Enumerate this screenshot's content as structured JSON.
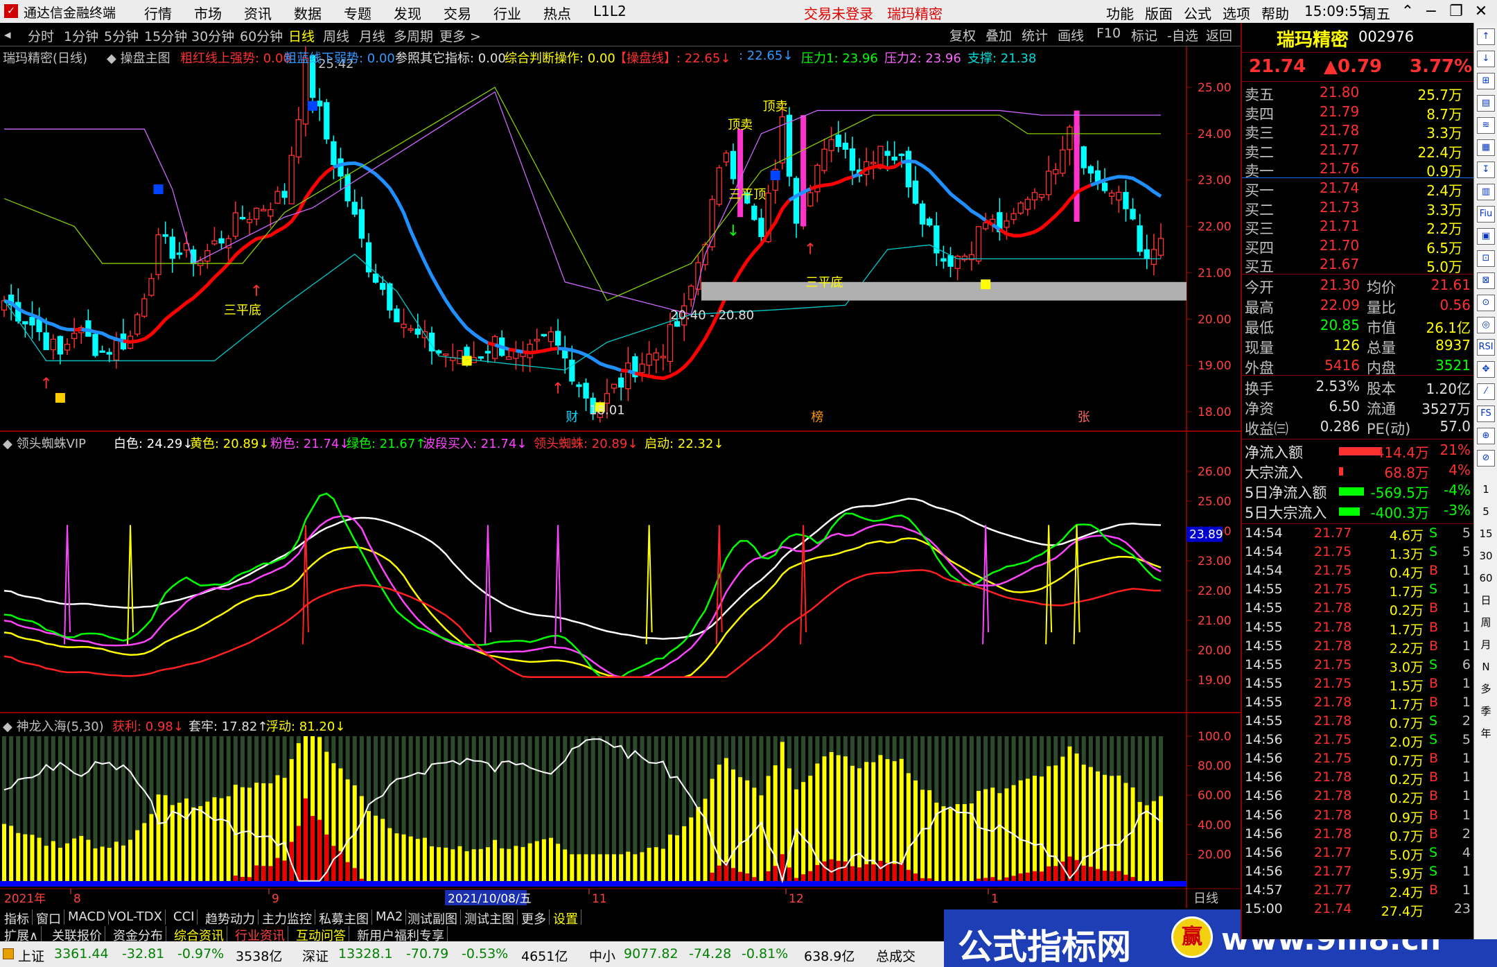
{
  "app": {
    "title": "通达信金融终端",
    "menu": [
      "行情",
      "市场",
      "资讯",
      "数据",
      "专题",
      "发现",
      "交易",
      "行业",
      "热点",
      "L1L2"
    ],
    "login": "交易未登录",
    "stock_name": "瑞玛精密",
    "right_menu": [
      "功能",
      "版面",
      "公式",
      "选项",
      "帮助"
    ],
    "time": "15:09:55",
    "weekday": "周五"
  },
  "toolbar": {
    "periods": [
      "分时",
      "1分钟",
      "5分钟",
      "15分钟",
      "30分钟",
      "60分钟",
      "日线",
      "周线",
      "月线",
      "多周期",
      "更多 >"
    ],
    "right": [
      "复权",
      "叠加",
      "统计",
      "画线",
      "F10",
      "标记",
      "-自选",
      "返回"
    ]
  },
  "main_chart": {
    "header": [
      {
        "t": "瑞玛精密(日线)",
        "c": "#c0c0c0"
      },
      {
        "t": "◆ 操盘主图",
        "c": "#c0c0c0"
      },
      {
        "t": "粗红线上强势: 0.00",
        "c": "#ff3030"
      },
      {
        "t": "粗蓝线下弱势: 0.00",
        "c": "#3399ff"
      },
      {
        "t": "参照其它指标: 0.00",
        "c": "#e0e0e0"
      },
      {
        "t": "综合判断操作: 0.00",
        "c": "#ffff00"
      },
      {
        "t": "【操盘线】: 22.65↓",
        "c": "#ff3030"
      },
      {
        "t": ": 22.65↓",
        "c": "#3399ff"
      },
      {
        "t": "压力1: 23.96",
        "c": "#00ff00"
      },
      {
        "t": "压力2: 23.96",
        "c": "#ff66ff"
      },
      {
        "t": "支撑: 21.38",
        "c": "#00dddd"
      }
    ],
    "price_ticks": [
      "25.00",
      "24.00",
      "23.00",
      "22.00",
      "21.00",
      "20.00",
      "19.00",
      "18.00"
    ],
    "annotations": [
      {
        "t": "25.42",
        "c": "#c0c0c0"
      },
      {
        "t": "三平底",
        "c": "#ffff00"
      },
      {
        "t": "三平底",
        "c": "#ffff00"
      },
      {
        "t": "三平顶",
        "c": "#ffff00"
      },
      {
        "t": "顶卖",
        "c": "#ffff00"
      },
      {
        "t": "顶卖",
        "c": "#ffff00"
      },
      {
        "t": "20.40 - 20.80",
        "c": "#e0e0e0"
      },
      {
        "t": "18.01",
        "c": "#e0e0e0"
      },
      {
        "t": "财",
        "c": "#00ddff"
      },
      {
        "t": "榜",
        "c": "#ff9900"
      },
      {
        "t": "张",
        "c": "#ff6666"
      }
    ]
  },
  "spider": {
    "header": [
      {
        "t": "◆ 领头蜘蛛VIP",
        "c": "#c0c0c0"
      },
      {
        "t": "白色: 24.29↓",
        "c": "#ffffff"
      },
      {
        "t": "黄色: 20.89↓",
        "c": "#ffff00"
      },
      {
        "t": "粉色: 21.74↓",
        "c": "#ff44ff"
      },
      {
        "t": "绿色: 21.67↑",
        "c": "#00ff00"
      },
      {
        "t": "波段买入: 21.74↓",
        "c": "#ff44ff"
      },
      {
        "t": "领头蜘蛛: 20.89↓",
        "c": "#ff3030"
      },
      {
        "t": "启动: 22.32↓",
        "c": "#ffff00"
      }
    ],
    "ticks": [
      "26.00",
      "25.00",
      "24.00",
      "23.00",
      "22.00",
      "21.00",
      "20.00",
      "19.00"
    ],
    "highlight": "23.89"
  },
  "dragon": {
    "header": [
      {
        "t": "◆ 神龙入海(5,30)",
        "c": "#c0c0c0"
      },
      {
        "t": "获利: 0.98↓",
        "c": "#ff3030"
      },
      {
        "t": "套牢: 17.82↑",
        "c": "#e0e0e0"
      },
      {
        "t": "浮动: 81.20↓",
        "c": "#ffff00"
      }
    ],
    "ticks": [
      "100.0",
      "80.00",
      "60.00",
      "40.00",
      "20.00"
    ]
  },
  "date_axis": {
    "labels": [
      "2021年",
      "8",
      "9",
      "2021/10/08/五",
      "11",
      "12",
      "1"
    ],
    "period": "日线"
  },
  "bottom_tabs": [
    "指标",
    "窗口",
    "MACD",
    "VOL-TDX",
    "CCI",
    "趋势动力",
    "主力监控",
    "私募主图",
    "MA2",
    "测试副图",
    "测试主图",
    "更多",
    "设置"
  ],
  "bottom_tabs2": [
    "扩展∧",
    "关联报价",
    "资金分布",
    "综合资讯",
    "行业资讯",
    "互动问答",
    "新用户福利专享"
  ],
  "status": {
    "items": [
      {
        "name": "上证",
        "v": "3361.44",
        "d": "-32.81",
        "p": "-0.97%",
        "amt": "3538亿"
      },
      {
        "name": "深证",
        "v": "13328.1",
        "d": "-70.79",
        "p": "-0.53%",
        "amt": "4651亿"
      },
      {
        "name": "中小",
        "v": "9077.82",
        "d": "-74.28",
        "p": "-0.81%",
        "amt": "638.9亿"
      }
    ],
    "tail": "总成交"
  },
  "quote": {
    "name": "瑞玛精密",
    "code": "002976",
    "price": "21.74",
    "change": "▲0.79",
    "pct": "3.77%",
    "asks": [
      [
        "卖五",
        "21.80",
        "25.7万"
      ],
      [
        "卖四",
        "21.79",
        "8.7万"
      ],
      [
        "卖三",
        "21.78",
        "3.3万"
      ],
      [
        "卖二",
        "21.77",
        "22.4万"
      ],
      [
        "卖一",
        "21.76",
        "0.9万"
      ]
    ],
    "bids": [
      [
        "买一",
        "21.74",
        "2.4万"
      ],
      [
        "买二",
        "21.73",
        "3.3万"
      ],
      [
        "买三",
        "21.71",
        "2.2万"
      ],
      [
        "买四",
        "21.70",
        "6.5万"
      ],
      [
        "买五",
        "21.67",
        "5.0万"
      ]
    ],
    "stats": [
      [
        "今开",
        "21.30",
        "均价",
        "21.61"
      ],
      [
        "最高",
        "22.09",
        "量比",
        "0.56"
      ],
      [
        "最低",
        "20.85",
        "市值",
        "26.1亿"
      ],
      [
        "现量",
        "126",
        "总量",
        "8937"
      ],
      [
        "外盘",
        "5416",
        "内盘",
        "3521"
      ]
    ],
    "stats2": [
      [
        "换手",
        "2.53%",
        "股本",
        "1.20亿"
      ],
      [
        "净资",
        "6.50",
        "流通",
        "3527万"
      ],
      [
        "收益㈢",
        "0.286",
        "PE(动)",
        "57.0"
      ]
    ],
    "flows": [
      [
        "净流入额",
        "414.4万",
        "21%"
      ],
      [
        "大宗流入",
        "68.8万",
        "4%"
      ],
      [
        "5日净流入额",
        "-569.5万",
        "-4%"
      ],
      [
        "5日大宗流入",
        "-400.3万",
        "-3%"
      ]
    ],
    "ticks": [
      [
        "14:54",
        "21.77",
        "4.6万",
        "S",
        "5"
      ],
      [
        "14:54",
        "21.75",
        "1.3万",
        "S",
        "5"
      ],
      [
        "14:54",
        "21.75",
        "0.4万",
        "B",
        "1"
      ],
      [
        "14:55",
        "21.75",
        "1.7万",
        "S",
        "1"
      ],
      [
        "14:55",
        "21.78",
        "0.2万",
        "B",
        "1"
      ],
      [
        "14:55",
        "21.78",
        "1.7万",
        "B",
        "1"
      ],
      [
        "14:55",
        "21.78",
        "2.2万",
        "B",
        "1"
      ],
      [
        "14:55",
        "21.75",
        "3.0万",
        "S",
        "6"
      ],
      [
        "14:55",
        "21.75",
        "1.5万",
        "B",
        "1"
      ],
      [
        "14:55",
        "21.78",
        "1.7万",
        "B",
        "1"
      ],
      [
        "14:55",
        "21.78",
        "0.7万",
        "S",
        "2"
      ],
      [
        "14:56",
        "21.75",
        "2.0万",
        "S",
        "5"
      ],
      [
        "14:56",
        "21.75",
        "0.7万",
        "B",
        "1"
      ],
      [
        "14:56",
        "21.78",
        "0.2万",
        "B",
        "1"
      ],
      [
        "14:56",
        "21.78",
        "0.2万",
        "B",
        "1"
      ],
      [
        "14:56",
        "21.78",
        "0.9万",
        "B",
        "1"
      ],
      [
        "14:56",
        "21.78",
        "0.7万",
        "B",
        "2"
      ],
      [
        "14:56",
        "21.77",
        "5.0万",
        "S",
        "4"
      ],
      [
        "14:56",
        "21.77",
        "5.9万",
        "S",
        "1"
      ],
      [
        "14:57",
        "21.77",
        "2.4万",
        "B",
        "1"
      ],
      [
        "15:00",
        "21.74",
        "27.4万",
        "",
        "23"
      ]
    ]
  },
  "side_icons": [
    "↑",
    "↓",
    "⊞",
    "▤",
    "≋",
    "▦",
    "↧",
    "▥",
    "Fiu",
    "▣",
    "⊡",
    "⊠",
    "⊙",
    "◎",
    "RSI",
    "✥",
    "⁄",
    "FS",
    "⊕",
    "⊘",
    "1",
    "5",
    "15",
    "30",
    "60",
    "日",
    "周",
    "月",
    "N",
    "多",
    "季",
    "年"
  ],
  "ad": {
    "text": "公式指标网",
    "url": "www.9m8.cn",
    "logo": "赢"
  },
  "colors": {
    "up": "#ff3030",
    "down": "#00ffff",
    "ma_red": "#ff0000",
    "ma_blue": "#1e90ff",
    "yellow": "#ffff00"
  }
}
